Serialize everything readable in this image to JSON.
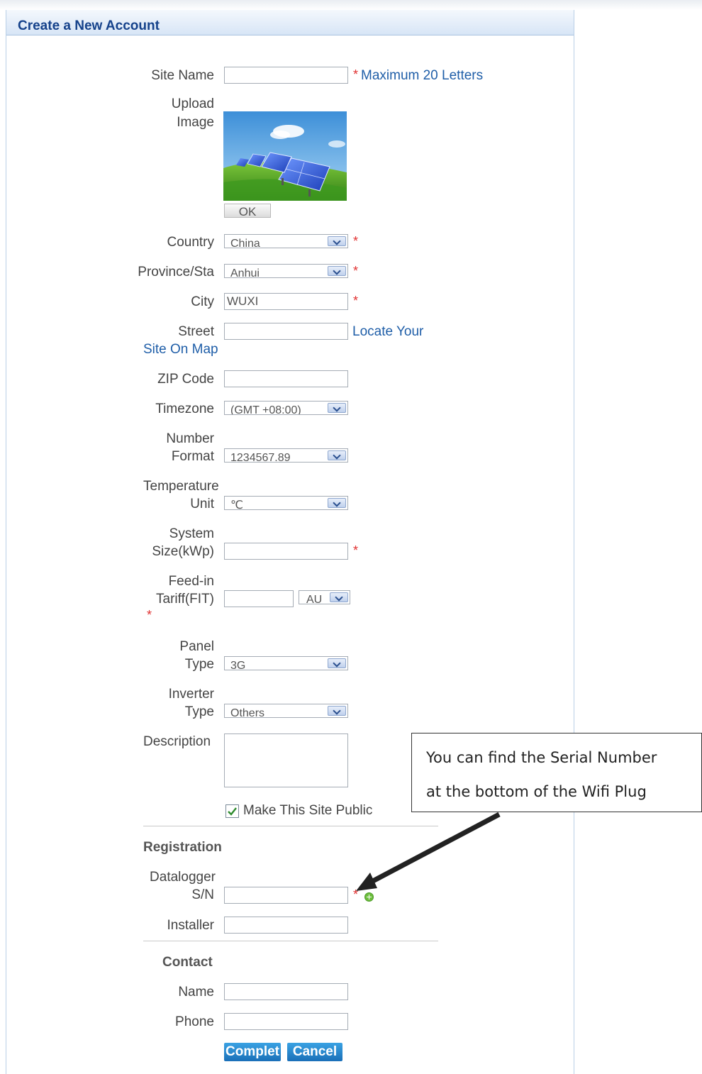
{
  "panel": {
    "title": "Create a New Account"
  },
  "form": {
    "site_name": {
      "label": "Site Name",
      "value": "",
      "hint_asterisk": "*",
      "hint": "Maximum 20 Letters"
    },
    "upload_image": {
      "label_line1": "Upload",
      "label_line2": "Image",
      "ok_label": "OK"
    },
    "country": {
      "label": "Country",
      "value": "China"
    },
    "province": {
      "label": "Province/Sta",
      "value": "Anhui"
    },
    "city": {
      "label": "City",
      "value": "WUXI"
    },
    "street": {
      "label": "Street",
      "value": "",
      "link_part1": "Locate Your",
      "link_part2": "Site On Map"
    },
    "zip": {
      "label": "ZIP Code",
      "value": ""
    },
    "timezone": {
      "label": "Timezone",
      "value": "(GMT +08:00)"
    },
    "number_format": {
      "label_line1": "Number",
      "label_line2": "Format",
      "value": "1234567.89"
    },
    "temperature_unit": {
      "label_line1": "Temperature",
      "label_line2": "Unit",
      "value": "℃"
    },
    "system_size": {
      "label_line1": "System",
      "label_line2": "Size(kWp)",
      "value": ""
    },
    "feed_in_tariff": {
      "label_line1": "Feed-in",
      "label_line2": "Tariff(FIT)",
      "value": "",
      "currency": "AU"
    },
    "panel_type": {
      "label_line1": "Panel",
      "label_line2": "Type",
      "value": "3G"
    },
    "inverter_type": {
      "label_line1": "Inverter",
      "label_line2": "Type",
      "value": "Others"
    },
    "description": {
      "label": "Description",
      "value": ""
    },
    "make_public": {
      "label": "Make This Site Public",
      "checked": true
    },
    "required_marker": "*"
  },
  "registration": {
    "heading": "Registration",
    "datalogger": {
      "label_line1": "Datalogger",
      "label_line2": "S/N",
      "value": ""
    },
    "installer": {
      "label": "Installer",
      "value": ""
    }
  },
  "contact": {
    "heading": "Contact",
    "name": {
      "label": "Name",
      "value": ""
    },
    "phone": {
      "label": "Phone",
      "value": ""
    }
  },
  "buttons": {
    "complete": "Complet",
    "cancel": "Cancel"
  },
  "callout": {
    "line1": "You can find the Serial Number",
    "line2": "at the bottom of the Wifi Plug"
  },
  "colors": {
    "title": "#15428b",
    "link": "#1f5ea8",
    "required": "#e03030",
    "button": "#1a6fb8"
  }
}
